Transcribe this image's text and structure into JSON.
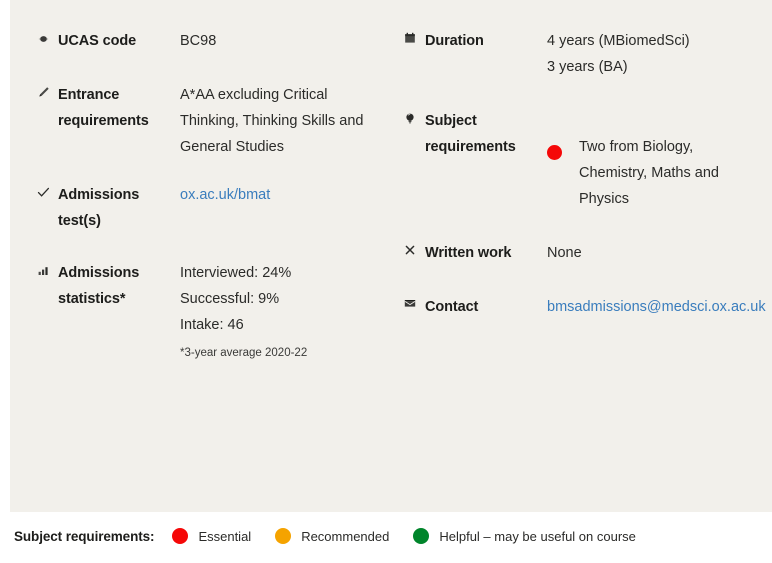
{
  "panel": {
    "rows_left": [
      {
        "icon": "ucas-badge-icon",
        "label": "UCAS code",
        "values": [
          "BC98"
        ]
      },
      {
        "icon": "pencil-icon",
        "label": "Entrance requirements",
        "values": [
          "A*AA excluding Critical Thinking, Thinking Skills and General Studies"
        ]
      },
      {
        "icon": "checkmark-icon",
        "label": "Admissions test(s)",
        "link_text": "ox.ac.uk/bmat"
      },
      {
        "icon": "bar-chart-icon",
        "label": "Admissions statistics*",
        "values": [
          "Interviewed: 24%",
          "Successful: 9%",
          "Intake: 46"
        ],
        "footnote": "*3-year average 2020-22"
      }
    ],
    "rows_right": [
      {
        "icon": "calendar-icon",
        "label": "Duration",
        "values": [
          "4 years (MBiomedSci)",
          "3 years (BA)"
        ]
      },
      {
        "icon": "lightbulb-icon",
        "label": "Subject requirements",
        "dot_color": "#f50808",
        "values": [
          "Two from Biology, Chemistry, Maths and Physics"
        ]
      },
      {
        "icon": "cross-icon",
        "label": "Written work",
        "values": [
          "None"
        ]
      },
      {
        "icon": "envelope-icon",
        "label": "Contact",
        "link_text": "bmsadmissions@medsci.ox.ac.uk"
      }
    ]
  },
  "legend": {
    "title": "Subject requirements:",
    "items": [
      {
        "color": "#f50808",
        "label": "Essential"
      },
      {
        "color": "#f5a300",
        "label": "Recommended"
      },
      {
        "color": "#00852b",
        "label": "Helpful – may be useful on course"
      }
    ]
  }
}
